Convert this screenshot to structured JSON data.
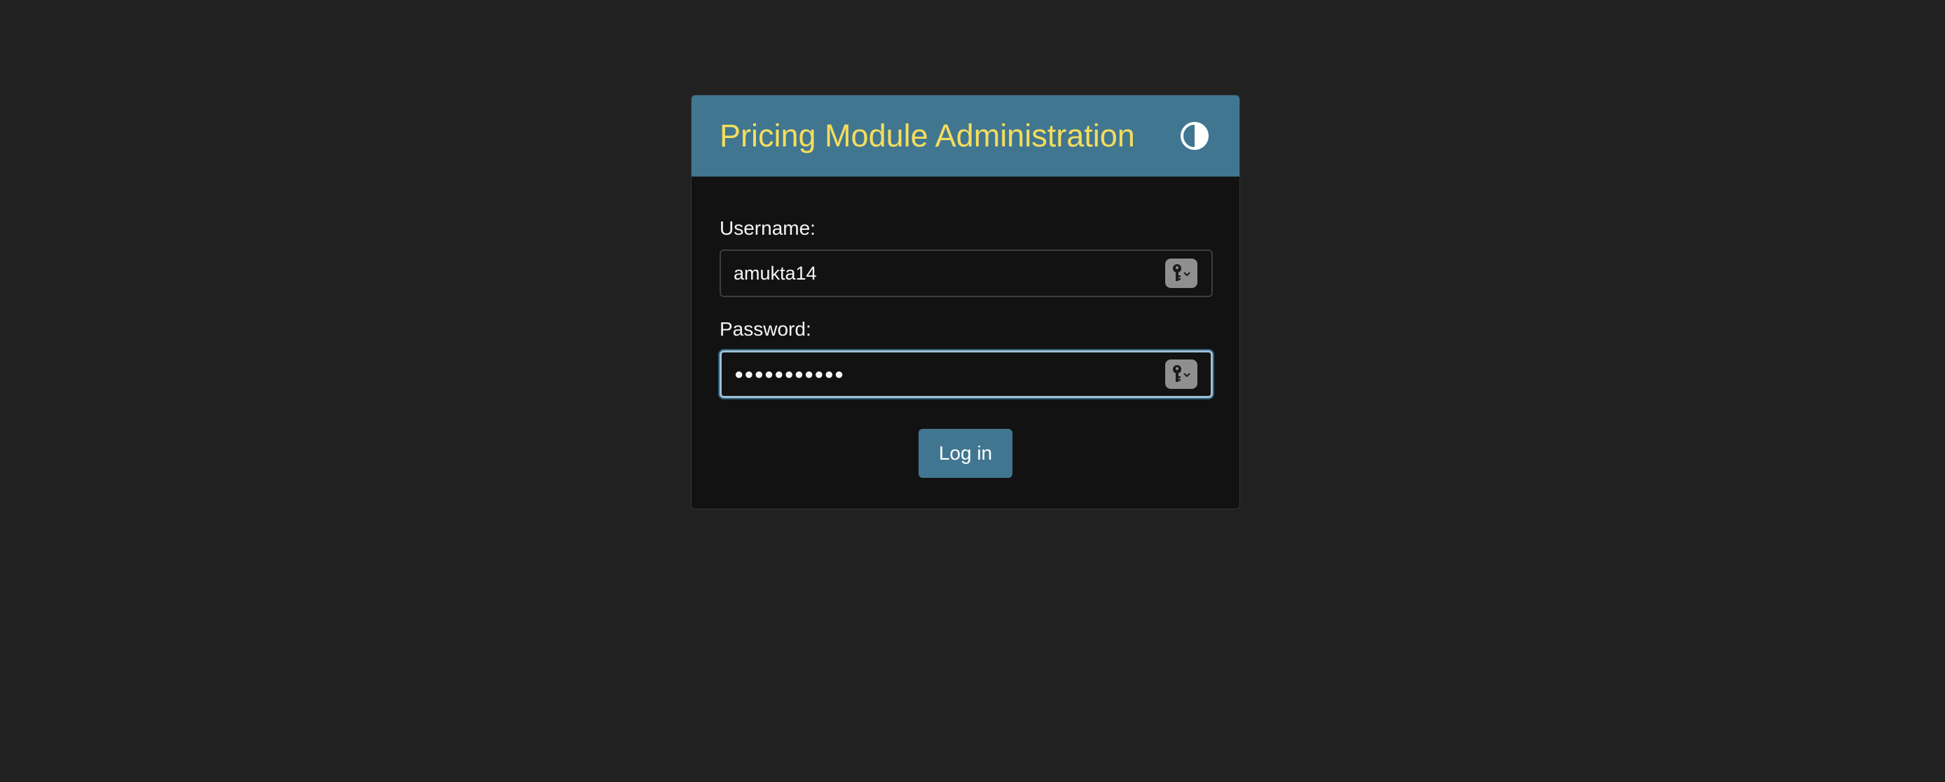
{
  "header": {
    "site_name": "Pricing Module Administration",
    "theme_toggle_icon": "half-circle-contrast-icon"
  },
  "form": {
    "username_label": "Username:",
    "username_value": "amukta14",
    "password_label": "Password:",
    "password_display": "●●●●●●●●●●●",
    "password_field_focused": true,
    "autofill_icon": "key-autofill-icon",
    "submit_label": "Log in"
  },
  "colors": {
    "page_background": "#212121",
    "panel_background": "#121212",
    "header_background": "#417690",
    "site_name_color": "#f5dd5d",
    "button_background": "#417690",
    "focus_ring": "#9fc0d4"
  }
}
